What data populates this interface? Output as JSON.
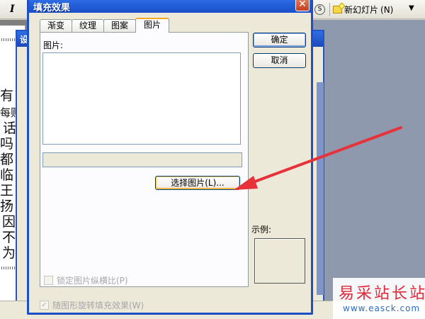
{
  "toolbar": {
    "italic_label": "I",
    "s_icon_label": "S",
    "new_slide_label": "新幻灯片",
    "new_slide_shortcut": "(N)"
  },
  "background": {
    "behind_dialog_title": "设",
    "doc_lines": [
      "有",
      "每贴",
      "话",
      "吗",
      "都",
      "临",
      "王",
      "扬",
      "因",
      "不",
      "为"
    ]
  },
  "dialog": {
    "title": "填充效果",
    "close_label": "✕",
    "tabs": [
      {
        "label": "渐变",
        "active": false
      },
      {
        "label": "纹理",
        "active": false
      },
      {
        "label": "图案",
        "active": false
      },
      {
        "label": "图片",
        "active": true
      }
    ],
    "picture_label": "图片:",
    "select_picture_button": "选择图片(L)...",
    "lock_aspect_label": "锁定图片纵横比(P)",
    "lock_aspect_checked": false,
    "ok_button": "确定",
    "cancel_button": "取消",
    "preview_label": "示例:",
    "rotate_with_shape_label": "随图形旋转填充效果(W)",
    "rotate_with_shape_checked": true,
    "check_mark": "✓"
  },
  "watermark": {
    "main": "易采站长站",
    "sub": "www.easck.com"
  },
  "colors": {
    "titlebar": "#2563dc",
    "annotation_arrow": "#e8323a",
    "watermark_red": "#e0283a",
    "watermark_blue": "#2d6bc4"
  }
}
